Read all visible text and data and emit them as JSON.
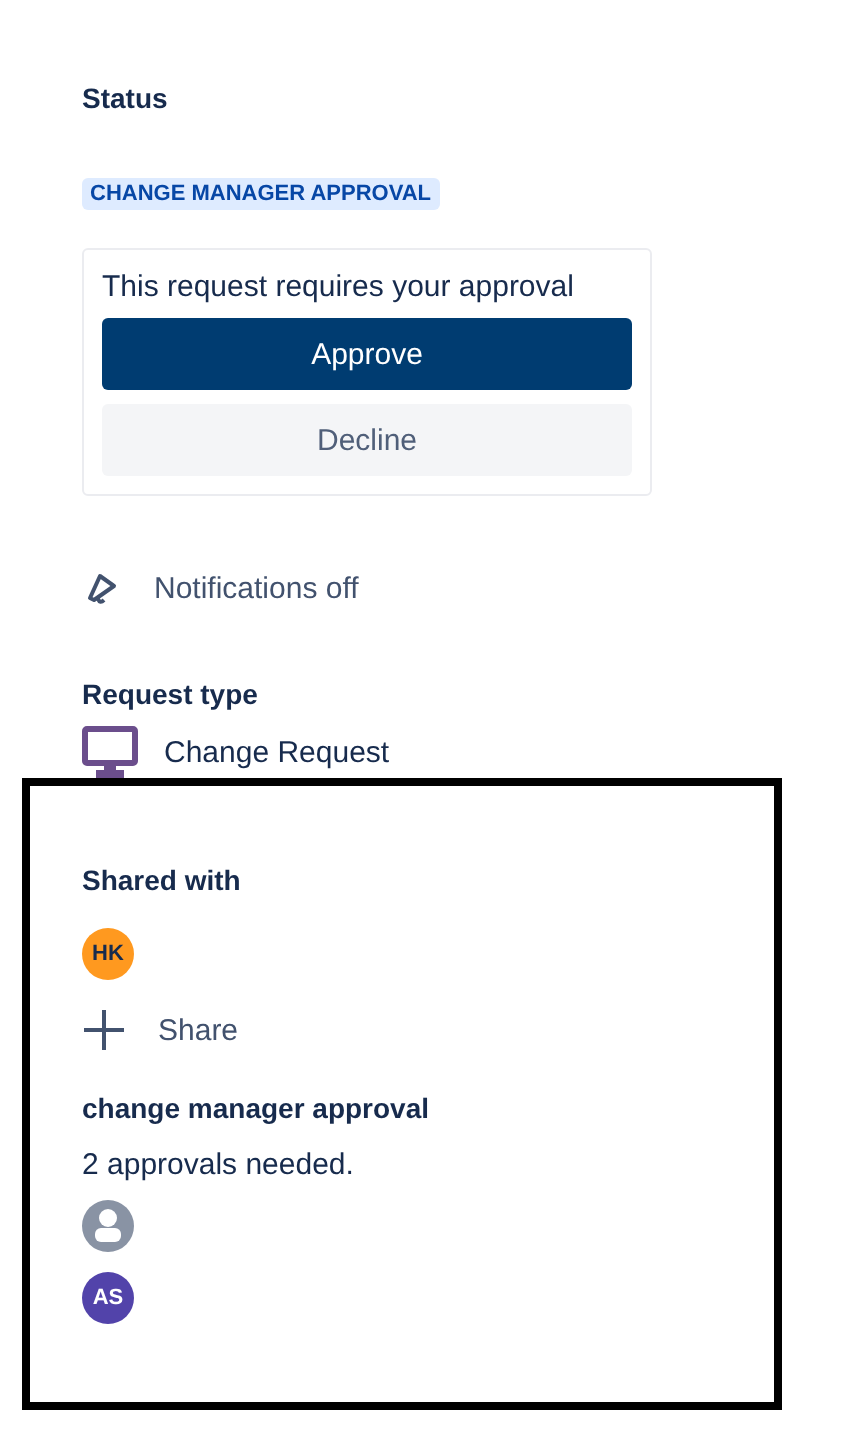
{
  "status": {
    "heading": "Status",
    "lozenge": "CHANGE MANAGER APPROVAL"
  },
  "approval_card": {
    "message": "This request requires your approval",
    "buttons": [
      {
        "label": "Approve",
        "kind": "primary"
      },
      {
        "label": "Decline",
        "kind": "subtle"
      }
    ]
  },
  "notifications": {
    "label": "Notifications off"
  },
  "request_type": {
    "heading": "Request type",
    "value": "Change Request"
  },
  "shared_with": {
    "heading": "Shared with",
    "people": [
      {
        "initials": "HK",
        "color": "#ff991f"
      }
    ],
    "share_button": "Share"
  },
  "approval_group": {
    "heading": "change manager approval",
    "note": "2 approvals needed.",
    "approvers": [
      {
        "kind": "placeholder",
        "color": "#8993a4"
      },
      {
        "kind": "initials",
        "initials": "AS",
        "color": "#5243aa"
      }
    ]
  },
  "highlight": {
    "kind": "frame"
  }
}
